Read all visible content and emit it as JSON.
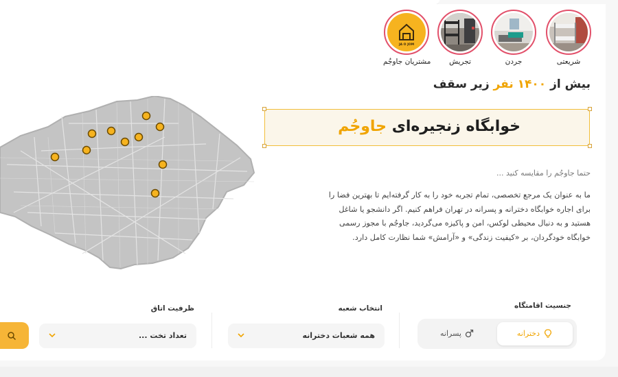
{
  "branches": [
    {
      "label": "شریعتی",
      "icon": "bunk-bed-room-photo"
    },
    {
      "label": "جردن",
      "icon": "single-bed-room-photo"
    },
    {
      "label": "تجریش",
      "icon": "bunk-bed-dorm-photo"
    },
    {
      "label": "مشتریان جاوجُم",
      "icon": "jajom-logo",
      "logo_text": "JA O JOM"
    }
  ],
  "headline": {
    "prefix": "بیش از",
    "number": "۱۴۰۰ نفر",
    "suffix": "زیر سقف"
  },
  "title": {
    "prefix": "خوابگاه زنجیره‌ای",
    "brand": "جاوجُم"
  },
  "subtitle": "حتما جاوجُم را مقایسه کنید ...",
  "description": "ما به عنوان یک مرجع تخصصی، تمام تجربه خود را به کار گرفته‌ایم تا بهترین فضا را برای اجاره خوابگاه دخترانه و پسرانه در تهران فراهم کنیم. اگر دانشجو یا شاغل هستید و به دنبال محیطی لوکس، امن و پاکیزه می‌گردید، جاوجُم با مجوز رسمی خوابگاه خودگردان، بر «کیفیت زندگی» و «آرامش» شما نظارت کامل دارد.",
  "map": {
    "icon": "tehran-map",
    "pin_icon": "location-pin-icon",
    "pin_count": 10
  },
  "search": {
    "gender_label": "جنسیت اقامتگاه",
    "gender_options": [
      "دخترانه",
      "پسرانه"
    ],
    "gender_selected": "دخترانه",
    "branch_label": "انتخاب شعبه",
    "branch_value": "همه شعبات دخترانه",
    "capacity_label": "ظرفیت اتاق",
    "capacity_placeholder": "تعداد تخت ...",
    "colors": {
      "accent": "#f0a400",
      "button": "#f6b537"
    }
  }
}
